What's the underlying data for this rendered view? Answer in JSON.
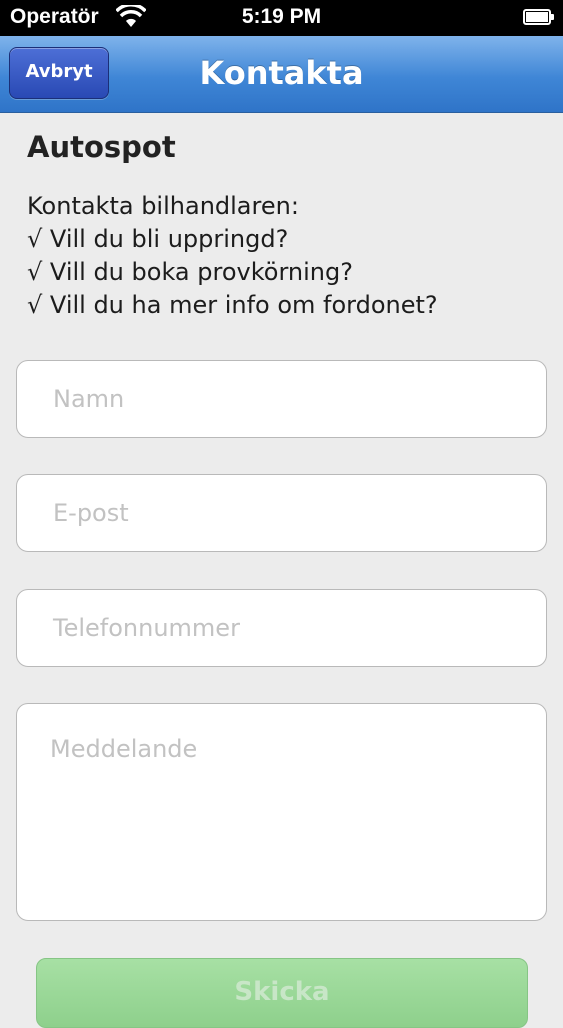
{
  "status_bar": {
    "carrier": "Operatör",
    "time": "5:19 PM"
  },
  "nav": {
    "cancel_label": "Avbryt",
    "title": "Kontakta"
  },
  "content": {
    "title": "Autospot",
    "intro_lines": [
      "Kontakta bilhandlaren:",
      "√ Vill du bli uppringd?",
      "√ Vill du boka provkörning?",
      "√ Vill du ha mer info om fordonet?"
    ]
  },
  "form": {
    "name_placeholder": "Namn",
    "email_placeholder": "E-post",
    "phone_placeholder": "Telefonnummer",
    "message_placeholder": "Meddelande",
    "send_label": "Skicka"
  },
  "colors": {
    "nav_blue": "#3f86d6",
    "cancel_blue": "#2949b4",
    "send_green": "#a7e0a4",
    "background": "#ececec"
  }
}
